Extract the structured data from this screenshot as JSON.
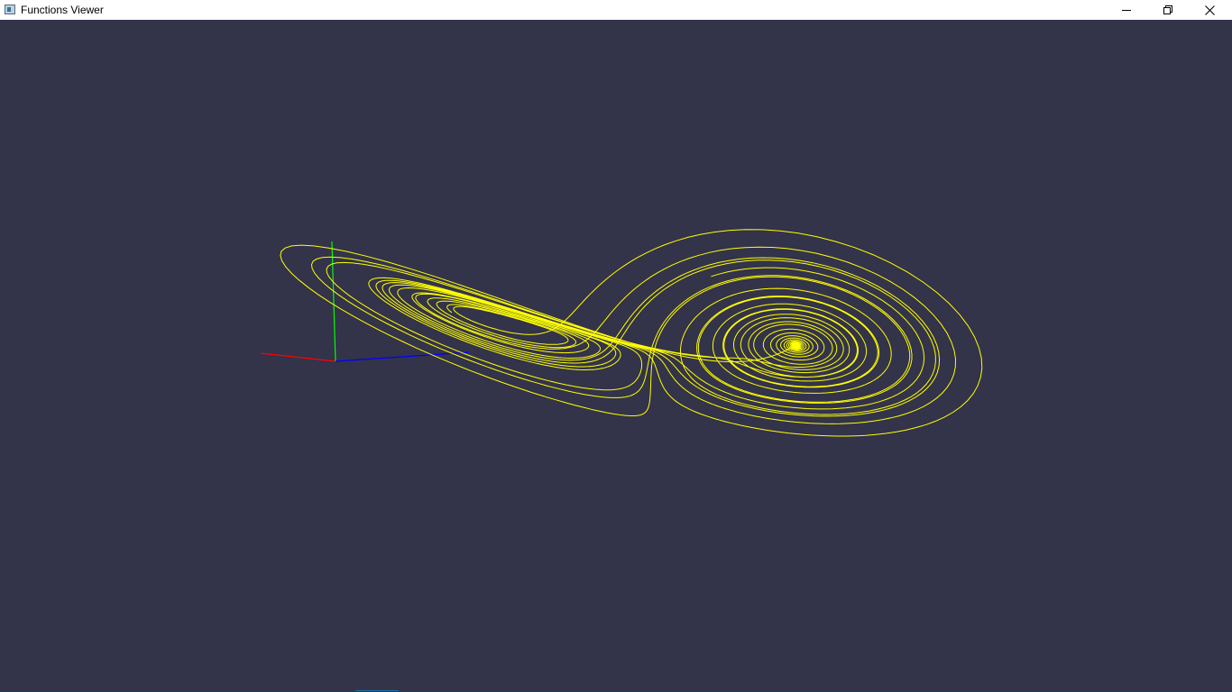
{
  "window": {
    "title": "Functions Viewer",
    "controls": [
      "minimize",
      "restore",
      "close"
    ]
  },
  "viewer": {
    "background_color": "#33334a",
    "curve_color": "#ffff00",
    "axes_colors": {
      "x": "#ff0000",
      "y": "#00ff00",
      "z": "#0000ff"
    },
    "icons": [
      "app-icon",
      "minimize-icon",
      "restore-icon",
      "close-icon"
    ]
  }
}
